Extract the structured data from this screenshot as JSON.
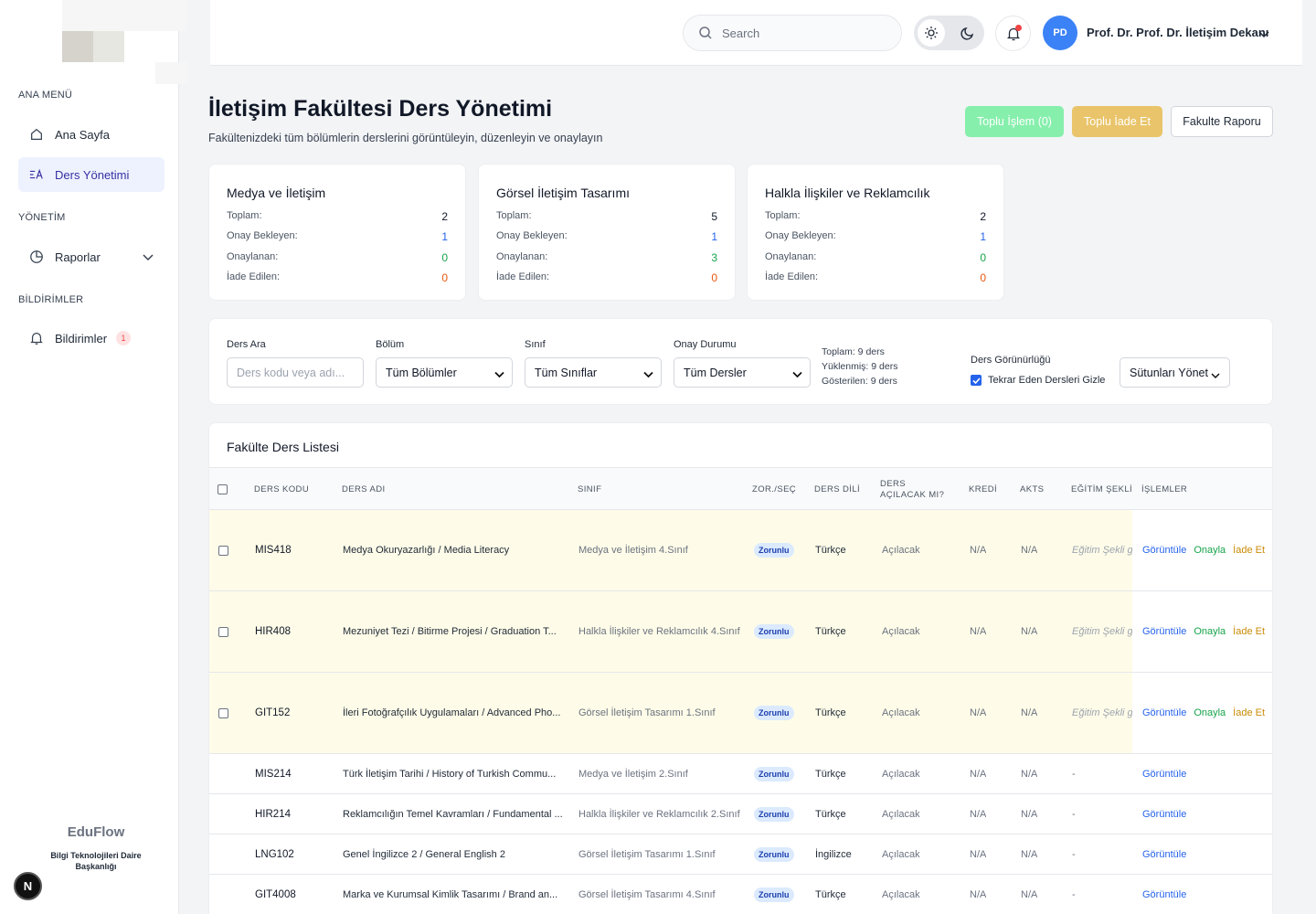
{
  "sidebar": {
    "sections": {
      "main": "ANA MENÜ",
      "management": "YÖNETİM",
      "notifications": "BİLDİRİMLER"
    },
    "items": [
      {
        "label": "Ana Sayfa",
        "icon": "home-icon",
        "active": false
      },
      {
        "label": "Ders Yönetimi",
        "icon": "course-list-icon",
        "active": true
      },
      {
        "label": "Raporlar",
        "icon": "pie-chart-icon",
        "active": false
      },
      {
        "label": "Bildirimler",
        "icon": "bell-icon",
        "badge": "1",
        "active": false
      }
    ],
    "brand": "EduFlow",
    "brand_sub": "Bilgi Teknolojileri Daire Başkanlığı",
    "corner_badge": "N"
  },
  "topbar": {
    "search_placeholder": "Search",
    "avatar_initials": "PD",
    "user_name": "Prof. Dr. Prof. Dr. İletişim Dekanı"
  },
  "header": {
    "title": "İletişim Fakültesi Ders Yönetimi",
    "subtitle": "Fakültenizdeki tüm bölümlerin derslerini görüntüleyin, düzenleyin ve onaylayın",
    "buttons": {
      "bulk_action": "Toplu İşlem (0)",
      "bulk_return": "Toplu İade Et",
      "faculty_report": "Fakulte Raporu"
    }
  },
  "stat_labels": {
    "total": "Toplam:",
    "pending": "Onay Bekleyen:",
    "approved": "Onaylanan:",
    "returned": "İade Edilen:"
  },
  "stat_cards": [
    {
      "title": "Medya ve İletişim",
      "total": "2",
      "pending": "1",
      "approved": "0",
      "returned": "0"
    },
    {
      "title": "Görsel İletişim Tasarımı",
      "total": "5",
      "pending": "1",
      "approved": "3",
      "returned": "0"
    },
    {
      "title": "Halkla İlişkiler ve Reklamcılık",
      "total": "2",
      "pending": "1",
      "approved": "0",
      "returned": "0"
    }
  ],
  "filters": {
    "search_label": "Ders Ara",
    "search_placeholder": "Ders kodu veya adı...",
    "department_label": "Bölüm",
    "department_value": "Tüm Bölümler",
    "class_label": "Sınıf",
    "class_value": "Tüm Sınıflar",
    "status_label": "Onay Durumu",
    "status_value": "Tüm Dersler",
    "summary_total": "Toplam: 9 ders",
    "summary_loaded": "Yüklenmiş: 9 ders",
    "summary_shown": "Gösterilen: 9 ders",
    "visibility_label": "Ders Görünürlüğü",
    "hide_repeating_label": "Tekrar Eden Dersleri Gizle",
    "manage_columns": "Sütunları Yönet"
  },
  "table": {
    "title": "Fakülte Ders Listesi",
    "headers": {
      "code": "DERS KODU",
      "name": "DERS ADI",
      "class": "SINIF",
      "type": "ZOR./SEÇ",
      "language": "DERS DİLİ",
      "open": "DERS AÇILACAK MI?",
      "credit": "KREDİ",
      "ects": "AKTS",
      "mode": "EĞİTİM ŞEKLİ",
      "actions": "İŞLEMLER"
    },
    "action_labels": {
      "view": "Görüntüle",
      "approve": "Onayla",
      "return": "İade Et"
    },
    "rows": [
      {
        "code": "MIS418",
        "name": "Medya Okuryazarlığı / Media Literacy",
        "class": "Medya ve İletişim 4.Sınıf",
        "type": "Zorunlu",
        "language": "Türkçe",
        "open": "Açılacak",
        "credit": "N/A",
        "ects": "N/A",
        "mode": "Eğitim Şekli g",
        "pending": true
      },
      {
        "code": "HIR408",
        "name": "Mezuniyet Tezi / Bitirme Projesi / Graduation T...",
        "class": "Halkla İlişkiler ve Reklamcılık 4.Sınıf",
        "type": "Zorunlu",
        "language": "Türkçe",
        "open": "Açılacak",
        "credit": "N/A",
        "ects": "N/A",
        "mode": "Eğitim Şekli g",
        "pending": true
      },
      {
        "code": "GIT152",
        "name": "İleri Fotoğrafçılık Uygulamaları / Advanced Pho...",
        "class": "Görsel İletişim Tasarımı 1.Sınıf",
        "type": "Zorunlu",
        "language": "Türkçe",
        "open": "Açılacak",
        "credit": "N/A",
        "ects": "N/A",
        "mode": "Eğitim Şekli g",
        "pending": true
      },
      {
        "code": "MIS214",
        "name": "Türk İletişim Tarihi / History of Turkish Commu...",
        "class": "Medya ve İletişim 2.Sınıf",
        "type": "Zorunlu",
        "language": "Türkçe",
        "open": "Açılacak",
        "credit": "N/A",
        "ects": "N/A",
        "mode": "-",
        "pending": false
      },
      {
        "code": "HIR214",
        "name": "Reklamcılığın Temel Kavramları / Fundamental ...",
        "class": "Halkla İlişkiler ve Reklamcılık 2.Sınıf",
        "type": "Zorunlu",
        "language": "Türkçe",
        "open": "Açılacak",
        "credit": "N/A",
        "ects": "N/A",
        "mode": "-",
        "pending": false
      },
      {
        "code": "LNG102",
        "name": "Genel İngilizce 2 / General English 2",
        "class": "Görsel İletişim Tasarımı 1.Sınıf",
        "type": "Zorunlu",
        "language": "İngilizce",
        "open": "Açılacak",
        "credit": "N/A",
        "ects": "N/A",
        "mode": "-",
        "pending": false
      },
      {
        "code": "GIT4008",
        "name": "Marka ve Kurumsal Kimlik Tasarımı / Brand an...",
        "class": "Görsel İletişim Tasarımı 4.Sınıf",
        "type": "Zorunlu",
        "language": "Türkçe",
        "open": "Açılacak",
        "credit": "N/A",
        "ects": "N/A",
        "mode": "-",
        "pending": false
      }
    ]
  }
}
